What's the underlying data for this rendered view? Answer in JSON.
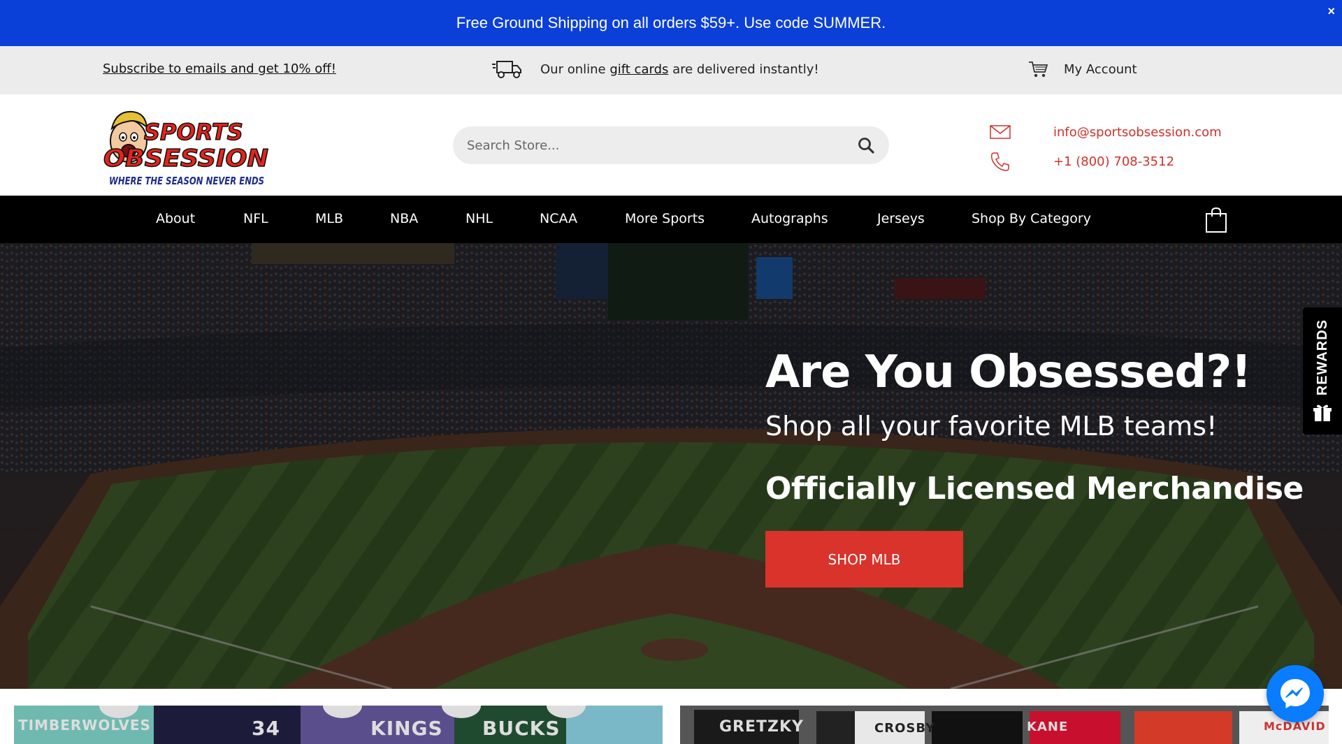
{
  "promo": {
    "text": "Free Ground Shipping on all orders $59+. Use code SUMMER.",
    "close_label": "×"
  },
  "util": {
    "subscribe": "Subscribe to emails and get 10% off!",
    "gift_prefix": "Our online ",
    "gift_link": "gift cards",
    "gift_suffix": " are delivered instantly!",
    "account": "My Account"
  },
  "header": {
    "logo_line1": "SPORTS",
    "logo_line2": "OBSESSION",
    "logo_tagline": "WHERE THE SEASON NEVER ENDS",
    "search_placeholder": "Search Store...",
    "email": "info@sportsobsession.com",
    "phone": "+1 (800) 708-3512"
  },
  "nav": {
    "items": [
      "About",
      "NFL",
      "MLB",
      "NBA",
      "NHL",
      "NCAA",
      "More Sports",
      "Autographs",
      "Jerseys",
      "Shop By Category"
    ]
  },
  "hero": {
    "title": "Are You Obsessed?!",
    "subtitle": "Shop all your favorite MLB teams!",
    "tagline": "Officially Licensed Merchandise",
    "button": "SHOP MLB"
  },
  "rewards": {
    "label": "REWARDS"
  },
  "tiles": {
    "left_labels": [
      "TIMBERWOLVES",
      "34",
      "KINGS",
      "BUCKS"
    ],
    "right_labels": [
      "GRETZKY",
      "CROSBY",
      "KANE",
      "McDAVID"
    ]
  },
  "colors": {
    "promo_blue": "#0a3fd8",
    "accent_red": "#d9332b",
    "messenger_blue": "#0a7cff"
  }
}
